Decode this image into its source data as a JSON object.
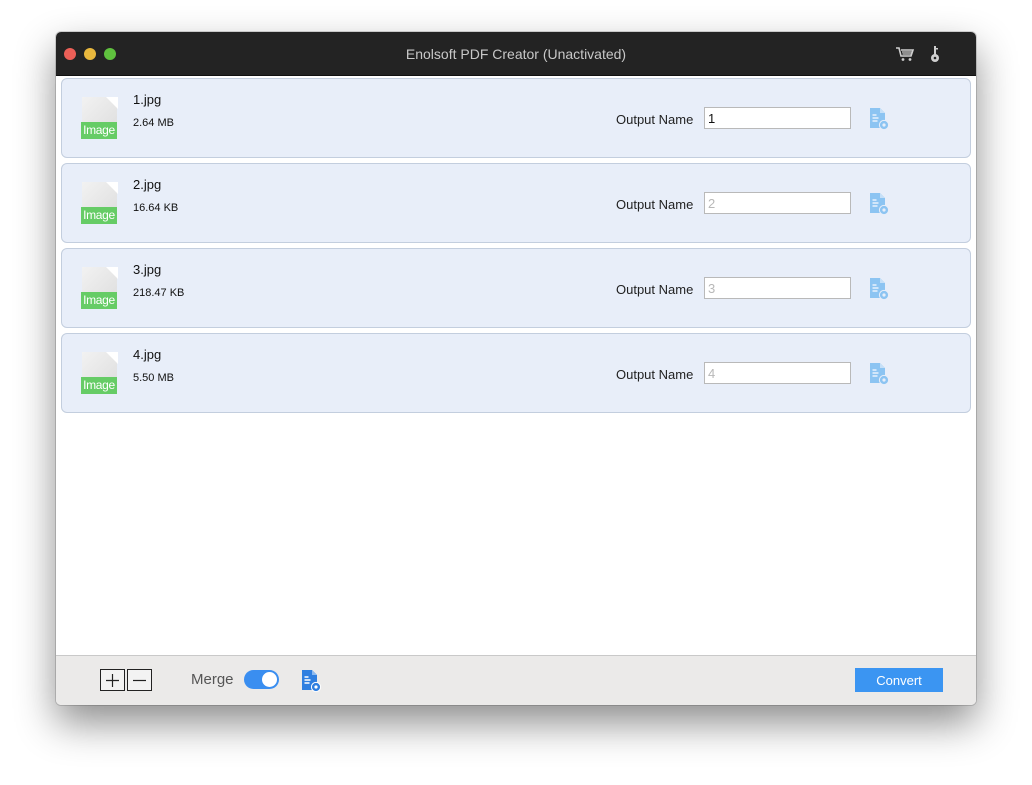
{
  "window": {
    "title": "Enolsoft PDF Creator (Unactivated)",
    "toolbar_icons": [
      "cart-icon",
      "key-icon"
    ]
  },
  "files": [
    {
      "name": "1.jpg",
      "size": "2.64 MB",
      "type_tag": "Image",
      "output_label": "Output Name",
      "output_value": "1",
      "output_placeholder": "1"
    },
    {
      "name": "2.jpg",
      "size": "16.64 KB",
      "type_tag": "Image",
      "output_label": "Output Name",
      "output_value": "",
      "output_placeholder": "2"
    },
    {
      "name": "3.jpg",
      "size": "218.47 KB",
      "type_tag": "Image",
      "output_label": "Output Name",
      "output_value": "",
      "output_placeholder": "3"
    },
    {
      "name": "4.jpg",
      "size": "5.50 MB",
      "type_tag": "Image",
      "output_label": "Output Name",
      "output_value": "",
      "output_placeholder": "4"
    }
  ],
  "footer": {
    "add_label": "+",
    "remove_label": "−",
    "merge_label": "Merge",
    "merge_enabled": true,
    "convert_label": "Convert"
  },
  "colors": {
    "accent": "#3b95f2",
    "row_bg": "#e8eef9",
    "image_tag": "#66cc66"
  }
}
